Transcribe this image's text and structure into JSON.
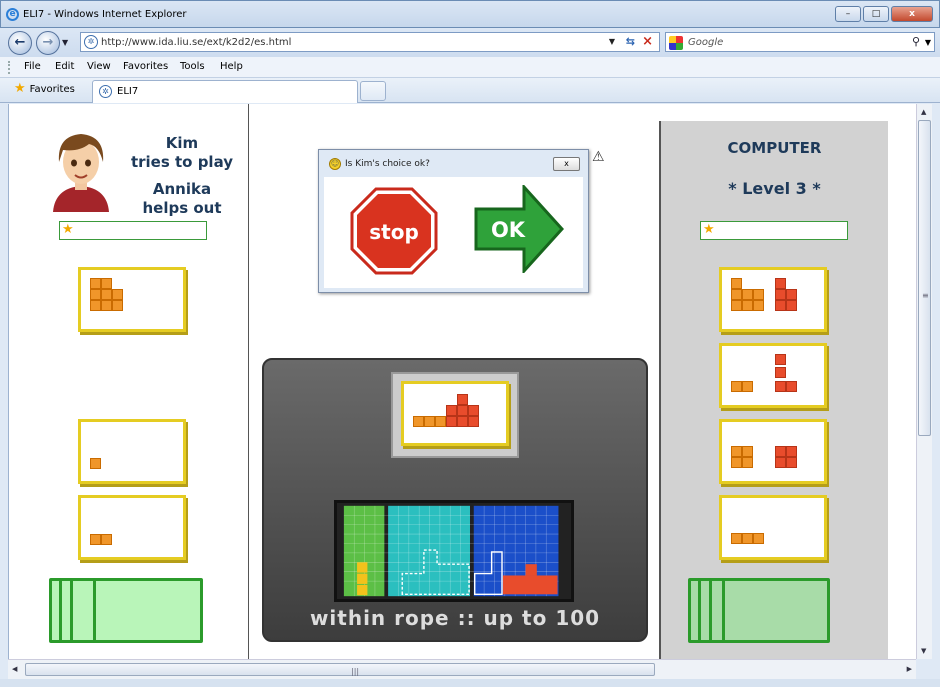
{
  "window": {
    "title": "ELI7 - Windows Internet Explorer",
    "min": "–",
    "max": "□",
    "close": "x"
  },
  "nav": {
    "url": "http://www.ida.liu.se/ext/k2d2/es.html",
    "search_placeholder": "Google"
  },
  "menu": [
    "File",
    "Edit",
    "View",
    "Favorites",
    "Tools",
    "Help"
  ],
  "favbar": {
    "favorites": "Favorites",
    "tab": "ELI7"
  },
  "player": {
    "name": "Kim",
    "action": "tries to play",
    "helper": "Annika",
    "helper_action": "helps out"
  },
  "dialog": {
    "title": "Is Kim's choice ok?",
    "close": "x",
    "stop_label": "stop",
    "ok_label": "OK"
  },
  "board": {
    "caption": "within rope :: up to 100"
  },
  "computer": {
    "title": "COMPUTER",
    "level": "* Level 3 *"
  },
  "colors": {
    "card_border": "#e5cc22",
    "block_orange": "#f0962a",
    "block_red": "#e84c2c",
    "green": "#2b9b2b",
    "title_blue": "#1e3a5a"
  }
}
